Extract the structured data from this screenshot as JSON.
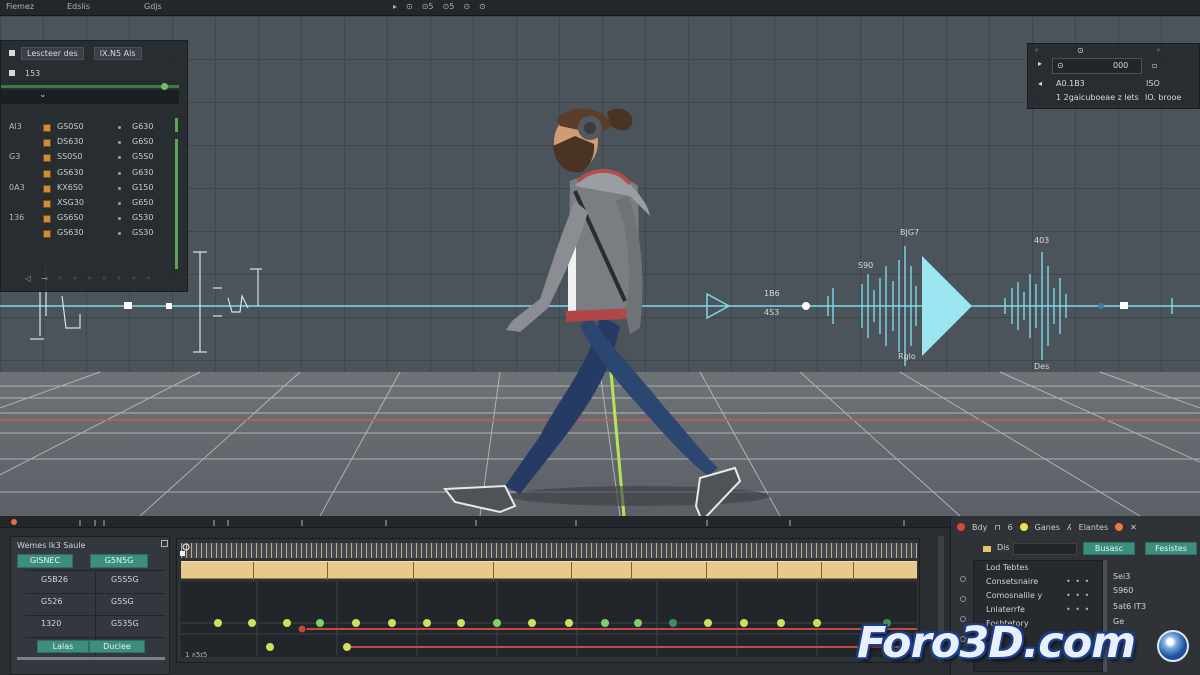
{
  "menubar": {
    "items": [
      "Fieme̵z",
      "Edslis",
      "Gdjs"
    ],
    "tools": [
      "▸",
      "⊙",
      "⊙5",
      "⊙5",
      "⊙",
      "⊙"
    ]
  },
  "outliner": {
    "search_label": "Lescteer des",
    "field_label": "lX.N5 Als",
    "sub_label": "153",
    "collapse_icon": "chevron-down-icon",
    "rows": [
      {
        "side": "Al3",
        "name": "GS0S0",
        "value": "G630"
      },
      {
        "side": "",
        "name": "DS630",
        "value": "G6S0"
      },
      {
        "side": "G3",
        "name": "SS0S0",
        "value": "G5S0"
      },
      {
        "side": "",
        "name": "GS630",
        "value": "G630"
      },
      {
        "side": "0A3",
        "name": "KX6S0",
        "value": "G150"
      },
      {
        "side": "",
        "name": "XSG30",
        "value": "G650"
      },
      {
        "side": "136",
        "name": "GS6S0",
        "value": "G530"
      },
      {
        "side": "",
        "name": "GS630",
        "value": "GS30"
      }
    ]
  },
  "props": {
    "value": "000",
    "line1": "A0.1B3",
    "line1_right": "ISO",
    "line2": "1 2gaicuboeae z lets",
    "line2_right": "IO. brooe"
  },
  "viewport": {
    "labels": {
      "top_left": "BJG7",
      "top_right": "403",
      "left1": "S90",
      "left2": "1B6",
      "left3": "4S3",
      "bottom1": "Rglo",
      "bottom2": "Des"
    },
    "floor_color": "#6a6f74",
    "axis_red": "#d0574d",
    "axis_green": "#b6e35a",
    "curve_color": "#7fd9ea"
  },
  "editor": {
    "left": {
      "title": "Wemes  lk3  Saule",
      "btn1": "GlSNEC",
      "btn2": "G5N5G",
      "cells": [
        "G5B26",
        "G5S5G",
        "G526",
        "G5SG",
        "1320",
        "G535G"
      ],
      "btn3": "Lalas",
      "btn4": "Duclee"
    },
    "timeline_label": "1 ʌ5ɪ5",
    "right": {
      "toolbar": [
        "Bdy",
        "6",
        "Ganes",
        "Elantes"
      ],
      "input_label": "Dis",
      "btn1": "Busasc",
      "btn2": "Fesistes",
      "items": [
        "Lod Tebtes",
        "Consetsnaire",
        "Comosnalile y",
        "Lnlaterrfe",
        "Fosbtetory"
      ],
      "col": [
        "Sei3",
        "S960",
        "5at6 IT3",
        "Ge"
      ]
    }
  },
  "watermark": "Foro3D.com"
}
